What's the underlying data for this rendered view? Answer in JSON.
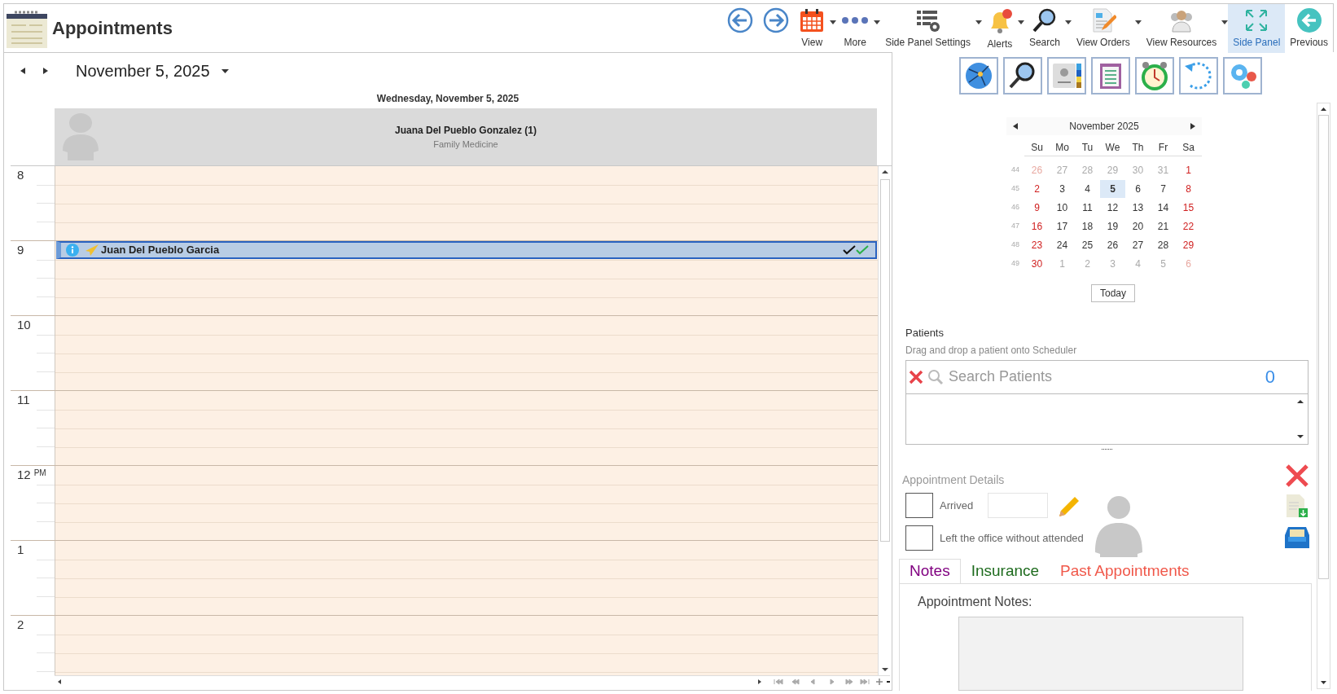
{
  "window": {
    "title": "Appointments"
  },
  "toolbar": [
    {
      "kind": "back",
      "selected": false,
      "dropdown": false
    },
    {
      "kind": "forward",
      "selected": false,
      "dropdown": false
    },
    {
      "kind": "calendar",
      "label": "View",
      "selected": false,
      "dropdown": true
    },
    {
      "kind": "more",
      "label": "More",
      "selected": false,
      "dropdown": true
    },
    {
      "kind": "settings",
      "label": "Side Panel Settings",
      "selected": false,
      "dropdown": true
    },
    {
      "kind": "bell",
      "label": "Alerts",
      "selected": false,
      "dropdown": true
    },
    {
      "kind": "search",
      "label": "Search",
      "selected": false,
      "dropdown": true
    },
    {
      "kind": "orders",
      "label": "View Orders",
      "selected": false,
      "dropdown": true
    },
    {
      "kind": "resources",
      "label": "View Resources",
      "selected": false,
      "dropdown": true
    },
    {
      "kind": "expand",
      "label": "Side Panel",
      "selected": true,
      "dropdown": false
    },
    {
      "kind": "previous",
      "label": "Previous",
      "selected": false,
      "dropdown": false
    }
  ],
  "scheduler": {
    "date": "November 5, 2025",
    "day_header": "Wednesday, November 5, 2025",
    "resource": {
      "name": "Juana Del Pueblo Gonzalez (1)",
      "specialty": "Family Medicine"
    },
    "hours": [
      {
        "label": "8"
      },
      {
        "label": "9",
        "appointments": [
          {
            "patient": "Juan Del Pueblo Garcia",
            "selected": true
          }
        ]
      },
      {
        "label": "10"
      },
      {
        "label": "11"
      },
      {
        "label": "12",
        "suffix": "PM"
      },
      {
        "label": "1"
      },
      {
        "label": "2"
      }
    ]
  },
  "mini_calendar": {
    "title": "November 2025",
    "weekdays": [
      "Su",
      "Mo",
      "Tu",
      "We",
      "Th",
      "Fr",
      "Sa"
    ],
    "weeks": [
      {
        "week": "44",
        "days": [
          {
            "label": "26",
            "muted": true,
            "selected": false
          },
          {
            "label": "27",
            "muted": true,
            "selected": false
          },
          {
            "label": "28",
            "muted": true,
            "selected": false
          },
          {
            "label": "29",
            "muted": true,
            "selected": false
          },
          {
            "label": "30",
            "muted": true,
            "selected": false
          },
          {
            "label": "31",
            "muted": true,
            "selected": false
          },
          {
            "label": "1",
            "muted": false,
            "selected": false
          }
        ]
      },
      {
        "week": "45",
        "days": [
          {
            "label": "2",
            "muted": false,
            "selected": false
          },
          {
            "label": "3",
            "muted": false,
            "selected": false
          },
          {
            "label": "4",
            "muted": false,
            "selected": false
          },
          {
            "label": "5",
            "muted": false,
            "selected": true
          },
          {
            "label": "6",
            "muted": false,
            "selected": false
          },
          {
            "label": "7",
            "muted": false,
            "selected": false
          },
          {
            "label": "8",
            "muted": false,
            "selected": false
          }
        ]
      },
      {
        "week": "46",
        "days": [
          {
            "label": "9",
            "muted": false,
            "selected": false
          },
          {
            "label": "10",
            "muted": false,
            "selected": false
          },
          {
            "label": "11",
            "muted": false,
            "selected": false
          },
          {
            "label": "12",
            "muted": false,
            "selected": false
          },
          {
            "label": "13",
            "muted": false,
            "selected": false
          },
          {
            "label": "14",
            "muted": false,
            "selected": false
          },
          {
            "label": "15",
            "muted": false,
            "selected": false
          }
        ]
      },
      {
        "week": "47",
        "days": [
          {
            "label": "16",
            "muted": false,
            "selected": false
          },
          {
            "label": "17",
            "muted": false,
            "selected": false
          },
          {
            "label": "18",
            "muted": false,
            "selected": false
          },
          {
            "label": "19",
            "muted": false,
            "selected": false
          },
          {
            "label": "20",
            "muted": false,
            "selected": false
          },
          {
            "label": "21",
            "muted": false,
            "selected": false
          },
          {
            "label": "22",
            "muted": false,
            "selected": false
          }
        ]
      },
      {
        "week": "48",
        "days": [
          {
            "label": "23",
            "muted": false,
            "selected": false
          },
          {
            "label": "24",
            "muted": false,
            "selected": false
          },
          {
            "label": "25",
            "muted": false,
            "selected": false
          },
          {
            "label": "26",
            "muted": false,
            "selected": false
          },
          {
            "label": "27",
            "muted": false,
            "selected": false
          },
          {
            "label": "28",
            "muted": false,
            "selected": false
          },
          {
            "label": "29",
            "muted": false,
            "selected": false
          }
        ]
      },
      {
        "week": "49",
        "days": [
          {
            "label": "30",
            "muted": false,
            "selected": false
          },
          {
            "label": "1",
            "muted": true,
            "selected": false
          },
          {
            "label": "2",
            "muted": true,
            "selected": false
          },
          {
            "label": "3",
            "muted": true,
            "selected": false
          },
          {
            "label": "4",
            "muted": true,
            "selected": false
          },
          {
            "label": "5",
            "muted": true,
            "selected": false
          },
          {
            "label": "6",
            "muted": true,
            "selected": false
          }
        ]
      }
    ],
    "today_button": "Today"
  },
  "patients": {
    "title": "Patients",
    "hint": "Drag and drop a patient onto Scheduler",
    "search_placeholder": "Search Patients",
    "count": "0"
  },
  "appointment_details": {
    "title": "Appointment Details",
    "checks": [
      {
        "label": "Arrived",
        "checked": false,
        "kind": "with_time"
      },
      {
        "label": "Left the office without attended",
        "checked": false,
        "kind": "plain"
      }
    ],
    "tabs": [
      {
        "label": "Notes",
        "selected": true,
        "color": "#800080"
      },
      {
        "label": "Insurance",
        "selected": false,
        "color": "#1e6b1e"
      },
      {
        "label": "Past Appointments",
        "selected": false,
        "color": "#f0584a"
      }
    ],
    "notes_label": "Appointment Notes:"
  }
}
